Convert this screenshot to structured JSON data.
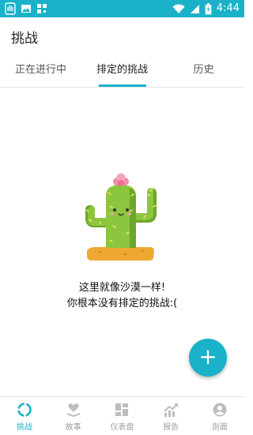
{
  "status_bar": {
    "time": "4:44"
  },
  "app_bar": {
    "title": "挑战"
  },
  "tabs": [
    {
      "label": "正在进行中"
    },
    {
      "label": "排定的挑战"
    },
    {
      "label": "历史"
    }
  ],
  "active_tab": "排定的挑战",
  "empty_state": {
    "line1": "这里就像沙漠一样!",
    "line2": "你根本没有排定的挑战:("
  },
  "fab": {
    "icon": "plus-icon",
    "label": "+"
  },
  "bottom_nav": [
    {
      "label": "挑战",
      "icon": "challenge-ring-icon"
    },
    {
      "label": "故事",
      "icon": "book-heart-icon"
    },
    {
      "label": "仪表盘",
      "icon": "dashboard-grid-icon"
    },
    {
      "label": "报告",
      "icon": "chart-trend-icon"
    },
    {
      "label": "剖面",
      "icon": "profile-icon"
    }
  ],
  "colors": {
    "accent": "#1ab2c9",
    "inactive": "#9e9e9e"
  }
}
